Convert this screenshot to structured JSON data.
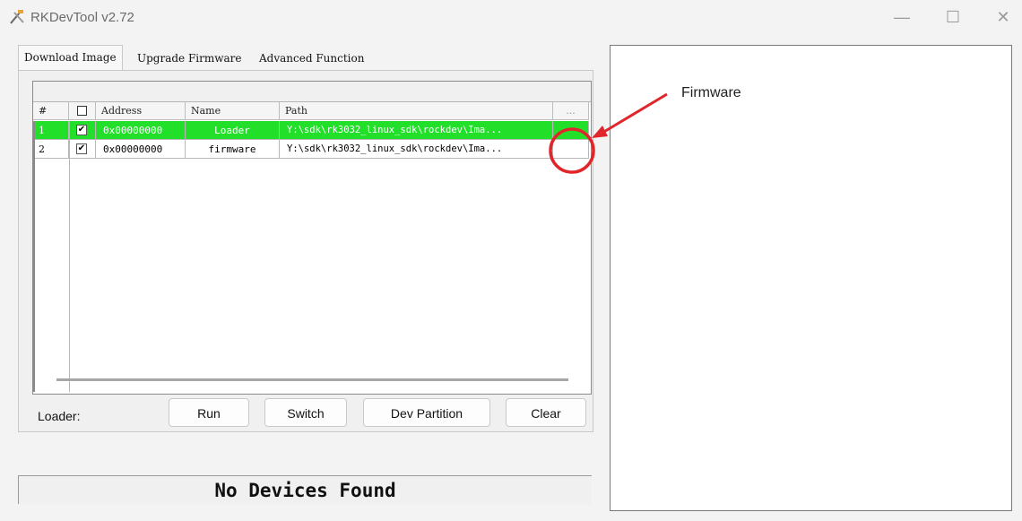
{
  "window": {
    "title": "RKDevTool v2.72",
    "controls": {
      "minimize": "—",
      "maximize": "☐",
      "close": "✕"
    }
  },
  "tabs": [
    {
      "label": "Download Image",
      "active": true
    },
    {
      "label": "Upgrade Firmware",
      "active": false
    },
    {
      "label": "Advanced Function",
      "active": false
    }
  ],
  "table": {
    "columns": [
      "#",
      "",
      "Address",
      "Name",
      "Path",
      "..."
    ],
    "rows": [
      {
        "num": "1",
        "checked": true,
        "address": "0x00000000",
        "name": "Loader",
        "path": "Y:\\sdk\\rk3032_linux_sdk\\rockdev\\Ima...",
        "selected": true
      },
      {
        "num": "2",
        "checked": true,
        "address": "0x00000000",
        "name": "firmware",
        "path": "Y:\\sdk\\rk3032_linux_sdk\\rockdev\\Ima...",
        "selected": false
      }
    ]
  },
  "loader_label": "Loader:",
  "buttons": {
    "run": "Run",
    "switch": "Switch",
    "dev_partition": "Dev Partition",
    "clear": "Clear"
  },
  "status": "No Devices Found",
  "annotation": {
    "label": "Firmware",
    "color": "#e0262b"
  },
  "colors": {
    "selected_row": "#22e02a",
    "annotation": "#e0262b"
  }
}
